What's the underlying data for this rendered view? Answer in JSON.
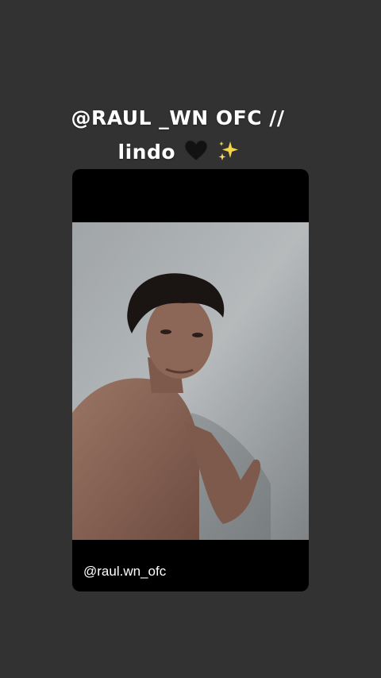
{
  "story": {
    "caption_line1": "@RAUL _WN OFC  //",
    "caption_line2": "lindo",
    "caption_emojis": [
      "black-heart-icon",
      "sparkles-icon"
    ]
  },
  "post": {
    "username": "@raul.wn_ofc"
  },
  "colors": {
    "background": "#333233",
    "card": "#000000",
    "text": "#ffffff",
    "sparkle": "#f5d547"
  }
}
